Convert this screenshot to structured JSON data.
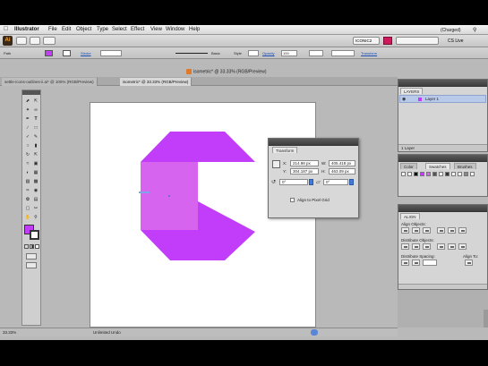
{
  "menubar": {
    "app": "Illustrator",
    "items": [
      "File",
      "Edit",
      "Object",
      "Type",
      "Select",
      "Effect",
      "View",
      "Window",
      "Help"
    ],
    "right_status": "(Charged)",
    "user": "CS Live"
  },
  "appbar": {
    "workspace": "ICONIC2"
  },
  "control": {
    "object_label": "Path",
    "stroke_label": "Stroke",
    "uniform_label": "Basic",
    "style_label": "Style",
    "opacity_label": "Opacity",
    "opacity_value": "100",
    "transform_link": "Transform"
  },
  "document": {
    "title": "isometric* @ 33.33% (RGB/Preview)",
    "tabs": [
      {
        "label": "settle-icons-outlines-ii.ai* @ 100% (RGB/Preview)",
        "active": false
      },
      {
        "label": "isometric* @ 33.33% (RGB/Preview)",
        "active": true
      }
    ]
  },
  "status": {
    "zoom": "33.33%",
    "info": "Unlimited Undo"
  },
  "transform_panel": {
    "tab": "Transform",
    "x_label": "X:",
    "x_value": "214.98 px",
    "y_label": "Y:",
    "y_value": "304.187 px",
    "w_label": "W:",
    "w_value": "405.418 px",
    "h_label": "H:",
    "h_value": "463.09 px",
    "rotate_value": "0°",
    "shear_value": "0°",
    "align_label": "Align to Pixel Grid"
  },
  "layers_panel": {
    "title": "LAYERS",
    "layer_name": "Layer 1",
    "footer": "1 Layer"
  },
  "swatches_panel": {
    "tabs": [
      "Color",
      "Swatches",
      "Brushes"
    ]
  },
  "align_panel": {
    "tabs": [
      "ALIGN"
    ],
    "align_objects": "Align Objects:",
    "distribute_objects": "Distribute Objects:",
    "distribute_spacing": "Distribute Spacing:",
    "align_to": "Align To:"
  },
  "colors": {
    "magenta_dark": "#c23dfa",
    "magenta_light": "#d664ee",
    "accent": "#d0185c"
  }
}
